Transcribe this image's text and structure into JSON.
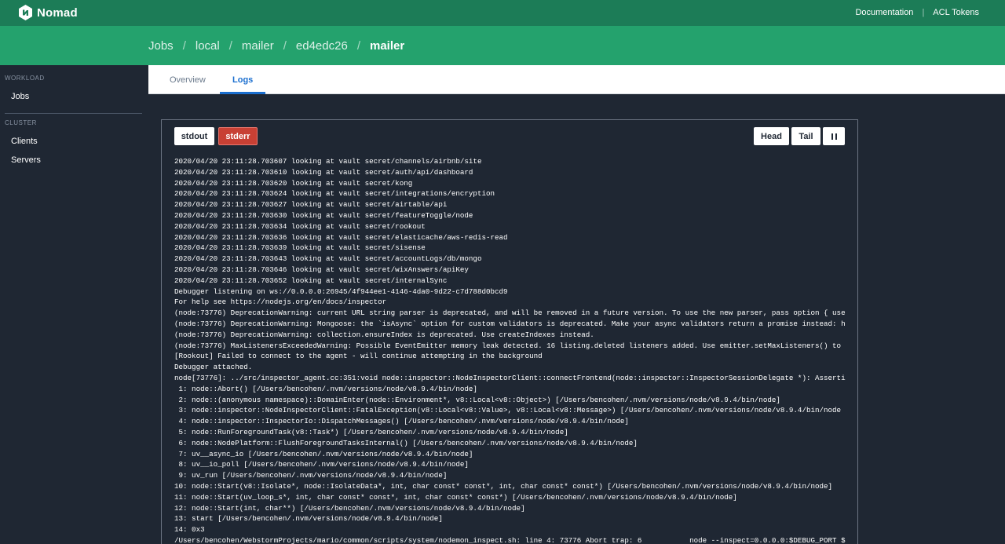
{
  "app": {
    "name": "Nomad"
  },
  "topnav": {
    "documentation": "Documentation",
    "separator": "|",
    "acl_tokens": "ACL Tokens"
  },
  "breadcrumbs": [
    "Jobs",
    "local",
    "mailer",
    "ed4edc26",
    "mailer"
  ],
  "breadcrumb_separator": "/",
  "sidebar": {
    "workload_heading": "WORKLOAD",
    "jobs": "Jobs",
    "cluster_heading": "CLUSTER",
    "clients": "Clients",
    "servers": "Servers"
  },
  "tabs": {
    "overview": "Overview",
    "logs": "Logs",
    "active": "logs"
  },
  "log_controls": {
    "stdout": "stdout",
    "stderr": "stderr",
    "head": "Head",
    "tail": "Tail",
    "pause_icon": "pause-icon",
    "active_stream": "stderr"
  },
  "colors": {
    "topnav": "#1c7c57",
    "breadcrumb_bar": "#24a26d",
    "background": "#1f2733",
    "stderr_active": "#c84034",
    "tab_active": "#1b6fcf"
  },
  "log_lines": [
    "2020/04/20 23:11:28.703607 looking at vault secret/channels/airbnb/site",
    "2020/04/20 23:11:28.703610 looking at vault secret/auth/api/dashboard",
    "2020/04/20 23:11:28.703620 looking at vault secret/kong",
    "2020/04/20 23:11:28.703624 looking at vault secret/integrations/encryption",
    "2020/04/20 23:11:28.703627 looking at vault secret/airtable/api",
    "2020/04/20 23:11:28.703630 looking at vault secret/featureToggle/node",
    "2020/04/20 23:11:28.703634 looking at vault secret/rookout",
    "2020/04/20 23:11:28.703636 looking at vault secret/elasticache/aws-redis-read",
    "2020/04/20 23:11:28.703639 looking at vault secret/sisense",
    "2020/04/20 23:11:28.703643 looking at vault secret/accountLogs/db/mongo",
    "2020/04/20 23:11:28.703646 looking at vault secret/wixAnswers/apiKey",
    "2020/04/20 23:11:28.703652 looking at vault secret/internalSync",
    "Debugger listening on ws://0.0.0.0:26945/4f944ee1-4146-4da0-9d22-c7d788d0bcd9",
    "For help see https://nodejs.org/en/docs/inspector",
    "(node:73776) DeprecationWarning: current URL string parser is deprecated, and will be removed in a future version. To use the new parser, pass option { use",
    "(node:73776) DeprecationWarning: Mongoose: the `isAsync` option for custom validators is deprecated. Make your async validators return a promise instead: h",
    "(node:73776) DeprecationWarning: collection.ensureIndex is deprecated. Use createIndexes instead.",
    "(node:73776) MaxListenersExceededWarning: Possible EventEmitter memory leak detected. 16 listing.deleted listeners added. Use emitter.setMaxListeners() to",
    "[Rookout] Failed to connect to the agent - will continue attempting in the background",
    "Debugger attached.",
    "node[73776]: ../src/inspector_agent.cc:351:void node::inspector::NodeInspectorClient::connectFrontend(node::inspector::InspectorSessionDelegate *): Asserti",
    " 1: node::Abort() [/Users/bencohen/.nvm/versions/node/v8.9.4/bin/node]",
    " 2: node::(anonymous namespace)::DomainEnter(node::Environment*, v8::Local<v8::Object>) [/Users/bencohen/.nvm/versions/node/v8.9.4/bin/node]",
    " 3: node::inspector::NodeInspectorClient::FatalException(v8::Local<v8::Value>, v8::Local<v8::Message>) [/Users/bencohen/.nvm/versions/node/v8.9.4/bin/node",
    " 4: node::inspector::InspectorIo::DispatchMessages() [/Users/bencohen/.nvm/versions/node/v8.9.4/bin/node]",
    " 5: node::RunForegroundTask(v8::Task*) [/Users/bencohen/.nvm/versions/node/v8.9.4/bin/node]",
    " 6: node::NodePlatform::FlushForegroundTasksInternal() [/Users/bencohen/.nvm/versions/node/v8.9.4/bin/node]",
    " 7: uv__async_io [/Users/bencohen/.nvm/versions/node/v8.9.4/bin/node]",
    " 8: uv__io_poll [/Users/bencohen/.nvm/versions/node/v8.9.4/bin/node]",
    " 9: uv_run [/Users/bencohen/.nvm/versions/node/v8.9.4/bin/node]",
    "10: node::Start(v8::Isolate*, node::IsolateData*, int, char const* const*, int, char const* const*) [/Users/bencohen/.nvm/versions/node/v8.9.4/bin/node]",
    "11: node::Start(uv_loop_s*, int, char const* const*, int, char const* const*) [/Users/bencohen/.nvm/versions/node/v8.9.4/bin/node]",
    "12: node::Start(int, char**) [/Users/bencohen/.nvm/versions/node/v8.9.4/bin/node]",
    "13: start [/Users/bencohen/.nvm/versions/node/v8.9.4/bin/node]",
    "14: 0x3",
    "/Users/bencohen/WebstormProjects/mario/common/scripts/system/nodemon_inspect.sh: line 4: 73776 Abort trap: 6           node --inspect=0.0.0.0:$DEBUG_PORT $"
  ]
}
